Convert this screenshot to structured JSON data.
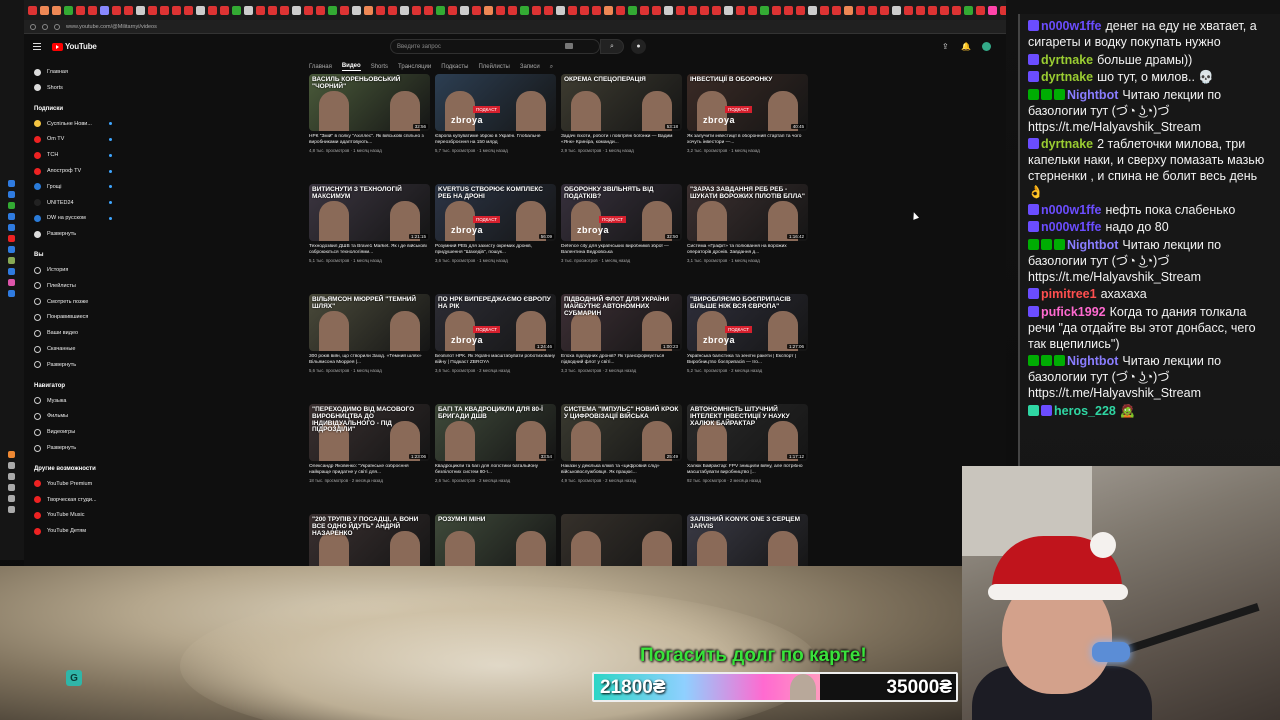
{
  "browser": {
    "url": "www.youtube.com/@Militarnyi/videos",
    "tab_colors": [
      "#d33",
      "#e85",
      "#e85",
      "#3a3",
      "#d33",
      "#d33",
      "#88f",
      "#d33",
      "#d33",
      "#ccc",
      "#d33",
      "#d33",
      "#d33",
      "#d33",
      "#ccc",
      "#d33",
      "#d33",
      "#3a3",
      "#ccc",
      "#d33",
      "#d33",
      "#d33",
      "#ccc",
      "#d33",
      "#d33",
      "#3a3",
      "#d33",
      "#ccc",
      "#e85",
      "#d33",
      "#d33",
      "#ccc",
      "#d33",
      "#d33",
      "#3a3",
      "#d33",
      "#ccc",
      "#d33",
      "#e85",
      "#d33",
      "#d33",
      "#3a3",
      "#d33",
      "#d33",
      "#ccc",
      "#d33",
      "#d33",
      "#d33",
      "#e85",
      "#d33",
      "#3a3",
      "#d33",
      "#d33",
      "#ccc",
      "#d33",
      "#d33",
      "#d33",
      "#d33",
      "#ccc",
      "#d33",
      "#d33",
      "#3a3",
      "#d33",
      "#d33",
      "#d33",
      "#ccc",
      "#d33",
      "#d33",
      "#e85",
      "#d33",
      "#d33",
      "#d33",
      "#ccc",
      "#d33",
      "#d33",
      "#d33",
      "#d33",
      "#d33",
      "#3a3",
      "#d33",
      "#ff44aa",
      "#d33",
      "#ccc",
      "#d33",
      "#d33",
      "#d33",
      "#ccc",
      "#d33",
      "#d33",
      "#d33",
      "#ccc"
    ]
  },
  "youtube": {
    "logo": "YouTube",
    "search_placeholder": "Введите запрос",
    "sidebar": {
      "main": [
        {
          "label": "Главная",
          "icon": "home-icon",
          "color": "#ddd"
        },
        {
          "label": "Shorts",
          "icon": "shorts-icon",
          "color": "#ddd"
        }
      ],
      "subs_title": "Подписки",
      "subs": [
        {
          "label": "Суспільне Нови...",
          "color": "#f4c542"
        },
        {
          "label": "Om TV",
          "color": "#e22"
        },
        {
          "label": "ТСН",
          "color": "#e22"
        },
        {
          "label": "Апостроф TV",
          "color": "#e22"
        },
        {
          "label": "Грощі",
          "color": "#2a7bd8"
        },
        {
          "label": "UNITED24",
          "color": "#222"
        },
        {
          "label": "DW на русском",
          "color": "#2a7bd8"
        },
        {
          "label": "Развернуть",
          "color": "#ddd"
        }
      ],
      "you_title": "Вы",
      "you": [
        {
          "label": "История",
          "icon": "history-icon"
        },
        {
          "label": "Плейлисты",
          "icon": "playlist-icon"
        },
        {
          "label": "Смотреть позже",
          "icon": "watch-later-icon"
        },
        {
          "label": "Понравившиеся",
          "icon": "like-icon"
        },
        {
          "label": "Ваши видео",
          "icon": "your-videos-icon"
        },
        {
          "label": "Скачанные",
          "icon": "download-icon"
        },
        {
          "label": "Развернуть",
          "icon": "chevron-down-icon"
        }
      ],
      "nav_title": "Навигатор",
      "nav": [
        {
          "label": "Музыка",
          "icon": "music-icon"
        },
        {
          "label": "Фильмы",
          "icon": "film-icon"
        },
        {
          "label": "Видеоигры",
          "icon": "gamepad-icon"
        },
        {
          "label": "Развернуть",
          "icon": "chevron-down-icon"
        }
      ],
      "more_title": "Другие возможности",
      "more": [
        {
          "label": "YouTube Premium",
          "color": "#e22"
        },
        {
          "label": "Творческая студи...",
          "color": "#e22"
        },
        {
          "label": "YouTube Music",
          "color": "#e22"
        },
        {
          "label": "YouTube Детям",
          "color": "#e22"
        }
      ]
    },
    "tabs": [
      "Главная",
      "Видео",
      "Shorts",
      "Трансляции",
      "Подкасты",
      "Плейлисты",
      "Записи"
    ],
    "active_tab": "Видео",
    "videos": [
      {
        "title": "НРК \"Змій\" в полку \"Ахіллес\". Як військові спільно з виробниками адаптовують...",
        "meta": "4,8 тыс. просмотров · 1 месяц назад",
        "thumb_text": "ВАСИЛЬ КОРЕНЬОВСЬКИЙ  \"ЧОРНИЙ\"",
        "duration": "32:56",
        "bg": "#4a5a3a"
      },
      {
        "title": "Європа купуватиме зброю в Україні. Глобальне переозброєння на 150 млрд",
        "meta": "5,7 тыс. просмотров · 1 месяц назад",
        "thumb_text": "",
        "duration": "",
        "bg": "#2c3e52",
        "brand": "zbroya"
      },
      {
        "title": "Задачі піхоти, роботи і повітряні боїонки — Вадим «Янк» Криніра, команди...",
        "meta": "2,9 тыс. просмотров · 1 месяц назад",
        "thumb_text": "ОКРЕМА СПЕЦОПЕРАЦІЯ",
        "duration": "53:18",
        "bg": "#3d3b30"
      },
      {
        "title": "Як залучити інвестиції в оборонний стартап та чого хочуть інвестори —...",
        "meta": "3,2 тыс. просмотров · 1 месяц назад",
        "thumb_text": "ІНВЕСТИЦІЇ В ОБОРОНКУ",
        "duration": "40:45",
        "bg": "#3a2a25",
        "brand": "zbroya"
      },
      {
        "title": "Технодозвил ДШВ та Brave1 Market. Як і де військові озброюються технологіями...",
        "meta": "5,1 тыс. просмотров · 1 месяц назад",
        "thumb_text": "ВИТИСНУТИ З ТЕХНОЛОГІЙ МАКСИМУМ",
        "duration": "1:21:15",
        "bg": "#3b3540"
      },
      {
        "title": "Розумний РЕБ для захисту окремих дронів, придушення \"Шахедів\", пошук...",
        "meta": "3,6 тыс. просмотров · 1 месяц назад",
        "thumb_text": "KVERTUS СТВОРЮЄ КОМПЛЕКС РЕБ НА ДРОНІ",
        "duration": "56:09",
        "bg": "#2b3445",
        "brand": "zbroya"
      },
      {
        "title": "Defence city для українських виробників зброї — Валентина Ведровська",
        "meta": "3 тыс. просмотров · 1 месяц назад",
        "thumb_text": "ОБОРОНКУ ЗВІЛЬНЯТЬ ВІД ПОДАТКІВ?",
        "duration": "32:50",
        "bg": "#37303c",
        "brand": "zbroya"
      },
      {
        "title": "Система «Графіт» та полювання на ворожих операторів дронів. Завдання д...",
        "meta": "3,1 тыс. просмотров · 1 месяц назад",
        "thumb_text": "\"ЗАРАЗ ЗАВДАННЯ РЕБ РЕБ - ШУКАТИ ВОРОЖИХ ПІЛОТІВ БПЛА\"",
        "duration": "1:16:42",
        "bg": "#3c3030"
      },
      {
        "title": "300 років війн, що створили Захід. «Темний шлях» Вільямсона Мюррея |...",
        "meta": "5,6 тыс. просмотров · 1 месяц назад",
        "thumb_text": "ВІЛЬЯМСОН МЮРРЕЙ \"ТЕМНИЙ ШЛЯХ\"",
        "duration": "",
        "bg": "#4a4a3a"
      },
      {
        "title": "Безпілот НРК. Як Україні масштабувати роботизовану війну | Подкаст ZBROYA",
        "meta": "3,6 тыс. просмотров · 2 месяца назад",
        "thumb_text": "ПО НРК ВИПЕРЕДЖАЄМО ЄВРОПУ НА РІК",
        "duration": "1:24:46",
        "bg": "#2c2c34",
        "brand": "zbroya"
      },
      {
        "title": "Епоха підводних дронів? Як трансформується підводний флот у світі...",
        "meta": "3,3 тыс. просмотров · 2 месяца назад",
        "thumb_text": "ПІДВОДНИЙ ФЛОТ ДЛЯ УКРАЇНИ МАЙБУТНЄ АВТОНОМНИХ СУБМАРИН",
        "duration": "1:00:23",
        "bg": "#3d2f35"
      },
      {
        "title": "Українська балістика та зенітні ракети | Експорт | Виробництво боєприпасів — Іго...",
        "meta": "5,2 тыс. просмотров · 2 месяца назад",
        "thumb_text": "\"ВИРОБЛЯЄМО БОЄПРИПАСІВ БІЛЬШЕ НІЖ ВСЯ ЄВРОПА\"",
        "duration": "1:27:06",
        "bg": "#2e2e3a",
        "brand": "zbroya"
      },
      {
        "title": "Олександр Яковенко: \"Українське озброєння найкраще придатне у світі для...",
        "meta": "18 тыс. просмотров · 2 месяца назад",
        "thumb_text": "\"ПЕРЕХОДИМО ВІД МАСОВОГО ВИРОБНИЦТВА ДО ІНДИВІДУАЛЬНОГО - ПІД ПІДРОЗДІЛИ\"",
        "duration": "1:23:06",
        "bg": "#3a3030"
      },
      {
        "title": "Квадроцикли та багі для логістики батальйону безпілотних систем 80-ї...",
        "meta": "2,6 тыс. просмотров · 2 месяца назад",
        "thumb_text": "БАГІ ТА КВАДРОЦИКЛИ ДЛЯ 80-Ї БРИГАДИ ДШВ",
        "duration": "33:54",
        "bg": "#3f4a3a"
      },
      {
        "title": "Накази у декілька кліків та «цифровий слід» військовослужбовця. Як працює...",
        "meta": "4,9 тыс. просмотров · 2 месяца назад",
        "thumb_text": "СИСТЕМА \"ІМПУЛЬС\"  НОВИЙ КРОК У ЦИФРОВІЗАЦІЇ ВІЙСЬКА",
        "duration": "25:49",
        "bg": "#3a3a30"
      },
      {
        "title": "Халюк Байрактар: FPV знищили війну, але потрібно масштабувати виробництво |...",
        "meta": "92 тыс. просмотров · 2 месяца назад",
        "thumb_text": "АВТОНОМНІСТЬ ШТУЧНИЙ ІНТЕЛЕКТ ІНВЕСТИЦІЇ У НАУКУ  ХАЛЮК БАЙРАКТАР",
        "duration": "1:17:12",
        "bg": "#2a2a2a"
      },
      {
        "title": "",
        "meta": "",
        "thumb_text": "\"200 ТРУПІВ У ПОСАДЦІ, А ВОНИ ВСЕ ОДНО ЙДУТЬ\"  АНДРІЙ НАЗАРЕНКО",
        "duration": "",
        "bg": "#3a3030"
      },
      {
        "title": "",
        "meta": "",
        "thumb_text": "РОЗУМНІ МІНИ",
        "duration": "",
        "bg": "#3f4a3a"
      },
      {
        "title": "",
        "meta": "",
        "thumb_text": "",
        "duration": "",
        "bg": "#35302a"
      },
      {
        "title": "",
        "meta": "",
        "thumb_text": "ЗАЛІЗНИЙ KONYK ONE З СЕРЦЕМ JARVIS",
        "duration": "",
        "bg": "#3a3a45"
      }
    ]
  },
  "chat": {
    "messages": [
      {
        "nick": "n000w1ffe",
        "color": "#6b4dff",
        "text": "денег на еду не хватает, а сигареты и водку покупать нужно",
        "badges": [
          "#6b4dff"
        ]
      },
      {
        "nick": "dyrtnake",
        "color": "#9acd32",
        "text": "больше драмы))",
        "badges": [
          "#6b4dff"
        ]
      },
      {
        "nick": "dyrtnake",
        "color": "#9acd32",
        "text": "шо тут, о милов.. 💀",
        "badges": [
          "#6b4dff"
        ]
      },
      {
        "nick": "Nightbot",
        "color": "#8a7dff",
        "text": "Читаю лекции по базологии тут (づ◔ ͜ʖ◔)づ https://t.me/Halyavshik_Stream",
        "badges": [
          "#00ad03",
          "#00ad03",
          "#00ad03"
        ]
      },
      {
        "nick": "dyrtnake",
        "color": "#9acd32",
        "text": "2 таблеточки милова, три капельки наки, и сверху помазать мазью стерненки , и спина не болит весь день 👌",
        "badges": [
          "#6b4dff"
        ]
      },
      {
        "nick": "n000w1ffe",
        "color": "#6b4dff",
        "text": "нефть пока слабенько",
        "badges": [
          "#6b4dff"
        ]
      },
      {
        "nick": "n000w1ffe",
        "color": "#6b4dff",
        "text": "надо до 80",
        "badges": [
          "#6b4dff"
        ]
      },
      {
        "nick": "Nightbot",
        "color": "#8a7dff",
        "text": "Читаю лекции по базологии тут (づ◔ ͜ʖ◔)づ https://t.me/Halyavshik_Stream",
        "badges": [
          "#00ad03",
          "#00ad03",
          "#00ad03"
        ]
      },
      {
        "nick": "pimitree1",
        "color": "#ff4f4f",
        "text": "ахахаха",
        "badges": [
          "#6b4dff"
        ]
      },
      {
        "nick": "pufick1992",
        "color": "#ff6ad0",
        "text": "Когда то дания толкала речи \"да отдайте вы этот донбасс, чего так вцепились\")",
        "badges": [
          "#6b4dff"
        ]
      },
      {
        "nick": "Nightbot",
        "color": "#8a7dff",
        "text": "Читаю лекции по базологии тут (づ◔ ͜ʖ◔)づ https://t.me/Halyavshik_Stream",
        "badges": [
          "#00ad03",
          "#00ad03",
          "#00ad03"
        ]
      },
      {
        "nick": "heros_228",
        "color": "#2fd6a3",
        "text": "🧟",
        "badges": [
          "#2fd6a3",
          "#6b4dff"
        ]
      }
    ]
  },
  "donation_goal": {
    "title": "Погасить долг по карте!",
    "current": "21800₴",
    "target": "35000₴",
    "progress": 0.623
  },
  "scene": {
    "icon_glyph": "G"
  }
}
